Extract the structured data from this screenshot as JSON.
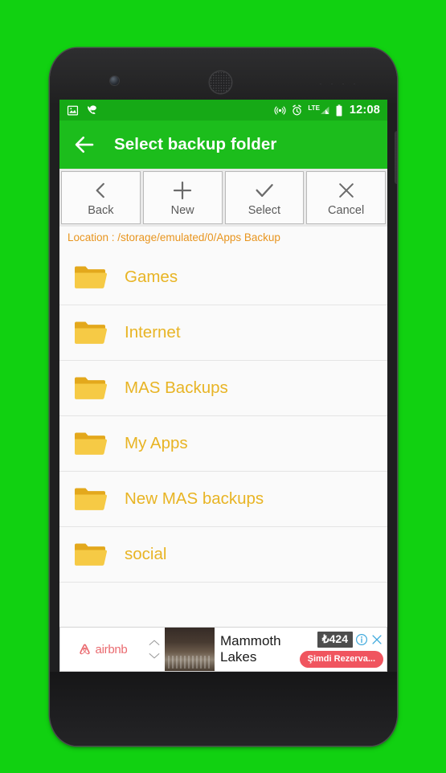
{
  "device": {
    "shell_color": "#1f1f20",
    "background_color": "#11d111"
  },
  "status_bar": {
    "background_color": "#16a916",
    "clock": "12:08",
    "left_icons": [
      "image-icon",
      "phone-message-icon"
    ],
    "right_icons": [
      "hotspot-icon",
      "alarm-icon",
      "lte-signal-icon",
      "battery-icon"
    ],
    "lte_label": "LTE"
  },
  "app_bar": {
    "background_color": "#1cbd1c",
    "back_icon": "arrow-left-icon",
    "title": "Select backup folder"
  },
  "toolbar": {
    "buttons": [
      {
        "label": "Back",
        "icon": "chevron-left-icon"
      },
      {
        "label": "New",
        "icon": "plus-icon"
      },
      {
        "label": "Select",
        "icon": "check-icon"
      },
      {
        "label": "Cancel",
        "icon": "close-x-icon"
      }
    ]
  },
  "location": {
    "text": "Location : /storage/emulated/0/Apps Backup",
    "color": "#e8951f"
  },
  "folder_list": {
    "item_color": "#e8b424",
    "items": [
      {
        "name": "Games"
      },
      {
        "name": "Internet"
      },
      {
        "name": "MAS Backups"
      },
      {
        "name": "My Apps"
      },
      {
        "name": "New MAS backups"
      },
      {
        "name": "social"
      }
    ]
  },
  "ad": {
    "brand": "airbnb",
    "brand_color": "#ea6b70",
    "headline_line1": "Mammoth",
    "headline_line2": "Lakes",
    "price": "₺424",
    "price_badge_color": "#4d4d4d",
    "cta_label": "Şimdi Rezerva...",
    "cta_color": "#f0555f",
    "info_icon": "info-circle-icon",
    "close_icon": "close-x-icon",
    "carousel_up_icon": "chevron-up-icon",
    "carousel_down_icon": "chevron-down-icon"
  },
  "nav_bar": {
    "background_color": "#000000",
    "buttons": [
      {
        "icon": "back-triangle-icon",
        "name": "nav-back-button"
      },
      {
        "icon": "home-circle-icon",
        "name": "nav-home-button"
      },
      {
        "icon": "recents-square-icon",
        "name": "nav-recents-button"
      }
    ]
  }
}
